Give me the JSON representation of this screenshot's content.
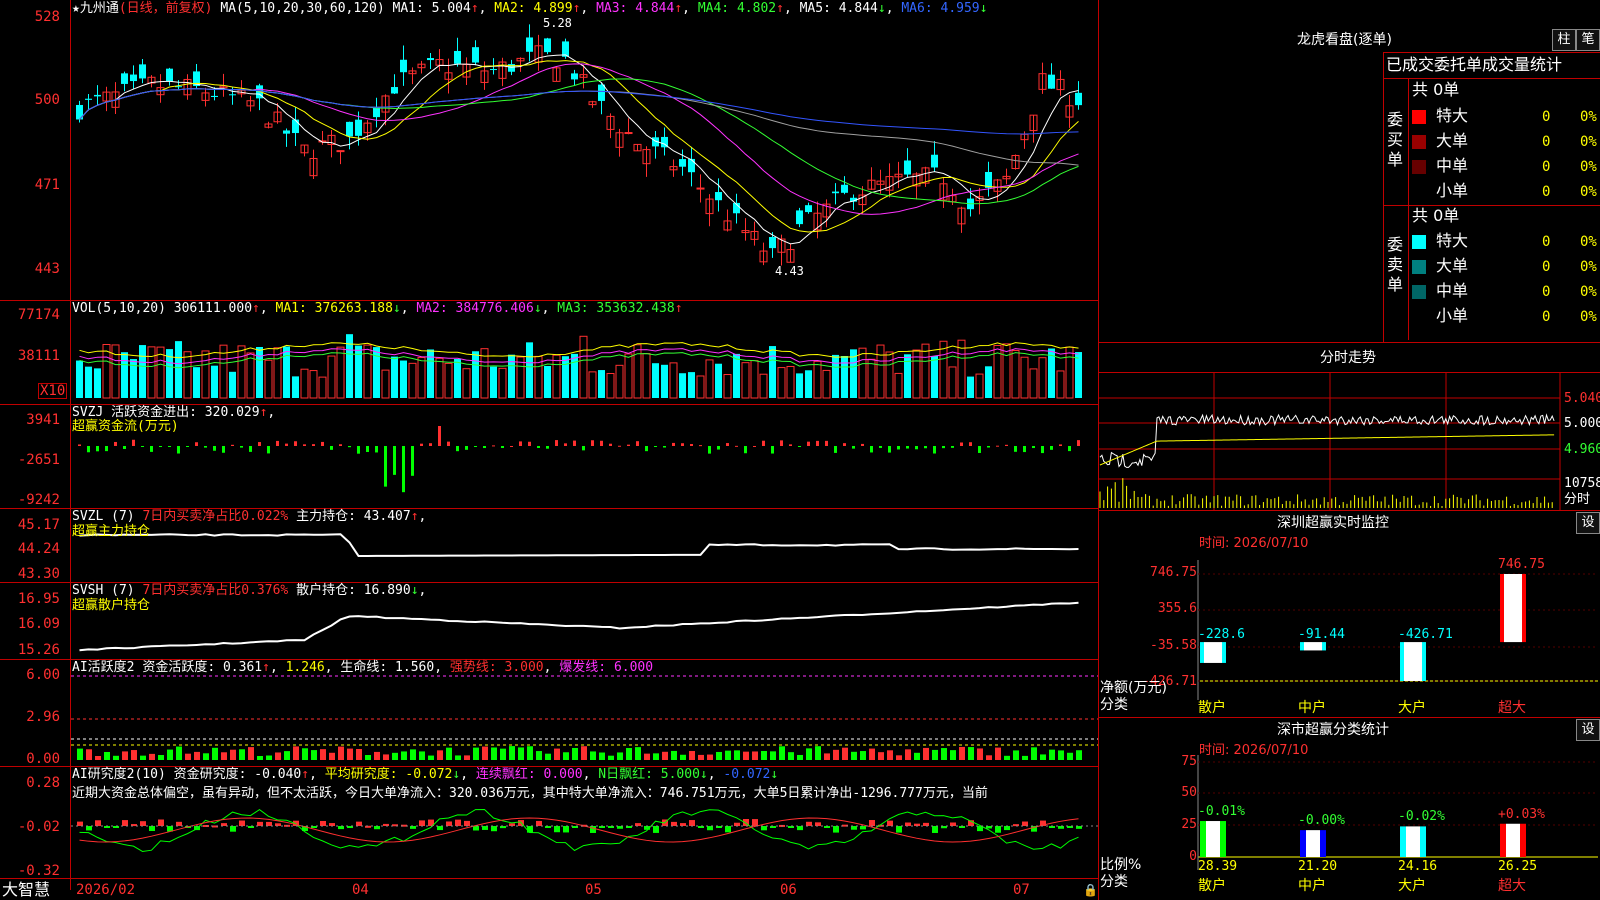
{
  "app_name": "大智慧",
  "main": {
    "star": "★",
    "stock": "九州通",
    "mode": "(日线，前复权)",
    "ma_label": "MA(5,10,20,30,60,120)",
    "ma1": "MA1: 5.004",
    "ma2": "MA2: 4.899",
    "ma3": "MA3: 4.844",
    "ma4": "MA4: 4.802",
    "ma5": "MA5: 4.844",
    "ma6": "MA6: 4.959",
    "high_mark": "5.28",
    "low_mark": "4.43",
    "y_ticks": [
      "528",
      "500",
      "471",
      "443"
    ],
    "arrow_up": "↑",
    "arrow_down": "↓"
  },
  "vol": {
    "label": "VOL(5,10,20)",
    "val": "306111.000",
    "ma1": "MA1: 376263.188",
    "ma2": "MA2: 384776.406",
    "ma3": "MA3: 353632.438",
    "y_ticks": [
      "77174",
      "38111"
    ],
    "unit": "X10"
  },
  "svzj": {
    "label": "SVZJ",
    "desc": "活跃资金进出: 320.029",
    "sub": "超赢资金流(万元)",
    "y_ticks": [
      "3941",
      "-2651",
      "-9242"
    ]
  },
  "svzl": {
    "label": "SVZL (7)",
    "desc_red": "7日内买卖净占比0.022%",
    "desc": "主力持仓: 43.407",
    "sub": "超赢主力持仓",
    "y_ticks": [
      "45.17",
      "44.24",
      "43.30"
    ]
  },
  "svsh": {
    "label": "SVSH (7)",
    "desc_red": "7日内买卖净占比0.376%",
    "desc": "散户持仓: 16.890",
    "sub": "超赢散户持仓",
    "y_ticks": [
      "16.95",
      "16.09",
      "15.26"
    ]
  },
  "ai_active": {
    "label": "AI活跃度2",
    "desc": "资金活跃度: 0.361",
    "v2": "1.246",
    "life": "生命线: 1.560",
    "strong": "强势线: 3.000",
    "burst": "爆发线: 6.000",
    "y_ticks": [
      "6.00",
      "2.96",
      "0.00"
    ]
  },
  "ai_research": {
    "label": "AI研究度2(10)",
    "r1": "资金研究度: -0.040",
    "r2": "平均研究度: -0.072",
    "r3": "连续飘红: 0.000",
    "r4": "N日飘红: 5.000",
    "r5": "-0.072",
    "comment": "近期大资金总体偏空，虽有异动，但不太活跃，今日大单净流入：320.036万元，其中特大单净流入：746.751万元，大单5日累计净出-1296.777万元，当前",
    "y_ticks": [
      "0.28",
      "-0.02",
      "-0.32"
    ]
  },
  "x_axis": [
    "2026/02",
    "04",
    "05",
    "06",
    "07"
  ],
  "lhb": {
    "title": "龙虎看盘(逐单)",
    "btn1": "柱",
    "btn2": "笔",
    "header": "已成交委托单成交量统计",
    "buy_side": "委买单",
    "sell_side": "委卖单",
    "buy_total": "共 0单",
    "sell_total": "共 0单",
    "buy_rows": [
      {
        "name": "特大",
        "val": "0",
        "pct": "0%",
        "color": "#ff0000"
      },
      {
        "name": "大单",
        "val": "0",
        "pct": "0%",
        "color": "#990000"
      },
      {
        "name": "中单",
        "val": "0",
        "pct": "0%",
        "color": "#660000"
      },
      {
        "name": "小单",
        "val": "0",
        "pct": "0%",
        "color": ""
      }
    ],
    "sell_rows": [
      {
        "name": "特大",
        "val": "0",
        "pct": "0%",
        "color": "#00ffff"
      },
      {
        "name": "大单",
        "val": "0",
        "pct": "0%",
        "color": "#008080"
      },
      {
        "name": "中单",
        "val": "0",
        "pct": "0%",
        "color": "#006666"
      },
      {
        "name": "小单",
        "val": "0",
        "pct": "0%",
        "color": ""
      }
    ]
  },
  "intraday": {
    "title": "分时走势",
    "p1": "5.040",
    "p2": "5.000",
    "p3": "4.960",
    "vol": "10758",
    "vol_label": "分时"
  },
  "sz_monitor": {
    "title": "深圳超赢实时监控",
    "btn": "设",
    "time": "时间: 2026/07/10",
    "y_ticks": [
      "746.75",
      "355.6",
      "-35.58",
      "-426.71"
    ],
    "y_title": "净额(万元)",
    "x_title": "分类",
    "bars": [
      {
        "cat": "散户",
        "value": -228.6,
        "label": "-228.6",
        "color": "#00ffff",
        "cat_color": "#ffff00"
      },
      {
        "cat": "中户",
        "value": -91.44,
        "label": "-91.44",
        "color": "#00ffff",
        "cat_color": "#ffff00"
      },
      {
        "cat": "大户",
        "value": -426.71,
        "label": "-426.71",
        "color": "#00ffff",
        "cat_color": "#ffff00"
      },
      {
        "cat": "超大",
        "value": 746.75,
        "label": "746.75",
        "color": "#ff0000",
        "cat_color": "#ff3030"
      }
    ]
  },
  "sz_stats": {
    "title": "深市超赢分类统计",
    "btn": "设",
    "time": "时间: 2026/07/10",
    "y_ticks": [
      "75",
      "50",
      "25",
      "0"
    ],
    "y_title": "比例%",
    "x_title": "分类",
    "bars": [
      {
        "cat": "散户",
        "value": 28.39,
        "label": "28.39",
        "top": "-0.01%",
        "color": "#00ff00",
        "top_color": "#33ff33",
        "cat_color": "#ffff00"
      },
      {
        "cat": "中户",
        "value": 21.2,
        "label": "21.20",
        "top": "-0.00%",
        "color": "#0000ff",
        "top_color": "#33ff33",
        "cat_color": "#ffff00"
      },
      {
        "cat": "大户",
        "value": 24.16,
        "label": "24.16",
        "top": "-0.02%",
        "color": "#00ffff",
        "top_color": "#33ff33",
        "cat_color": "#ffff00"
      },
      {
        "cat": "超大",
        "value": 26.25,
        "label": "26.25",
        "top": "+0.03%",
        "color": "#ff0000",
        "top_color": "#ff3030",
        "cat_color": "#ff3030"
      }
    ]
  },
  "colors": {
    "up": "#ff3030",
    "down": "#00ffff",
    "grid": "#c00000",
    "ma1": "#ffffff",
    "ma2": "#ffff00",
    "ma3": "#ff33ff",
    "ma4": "#33ff33",
    "ma5": "#a0a0a0",
    "ma6": "#3355ff"
  }
}
